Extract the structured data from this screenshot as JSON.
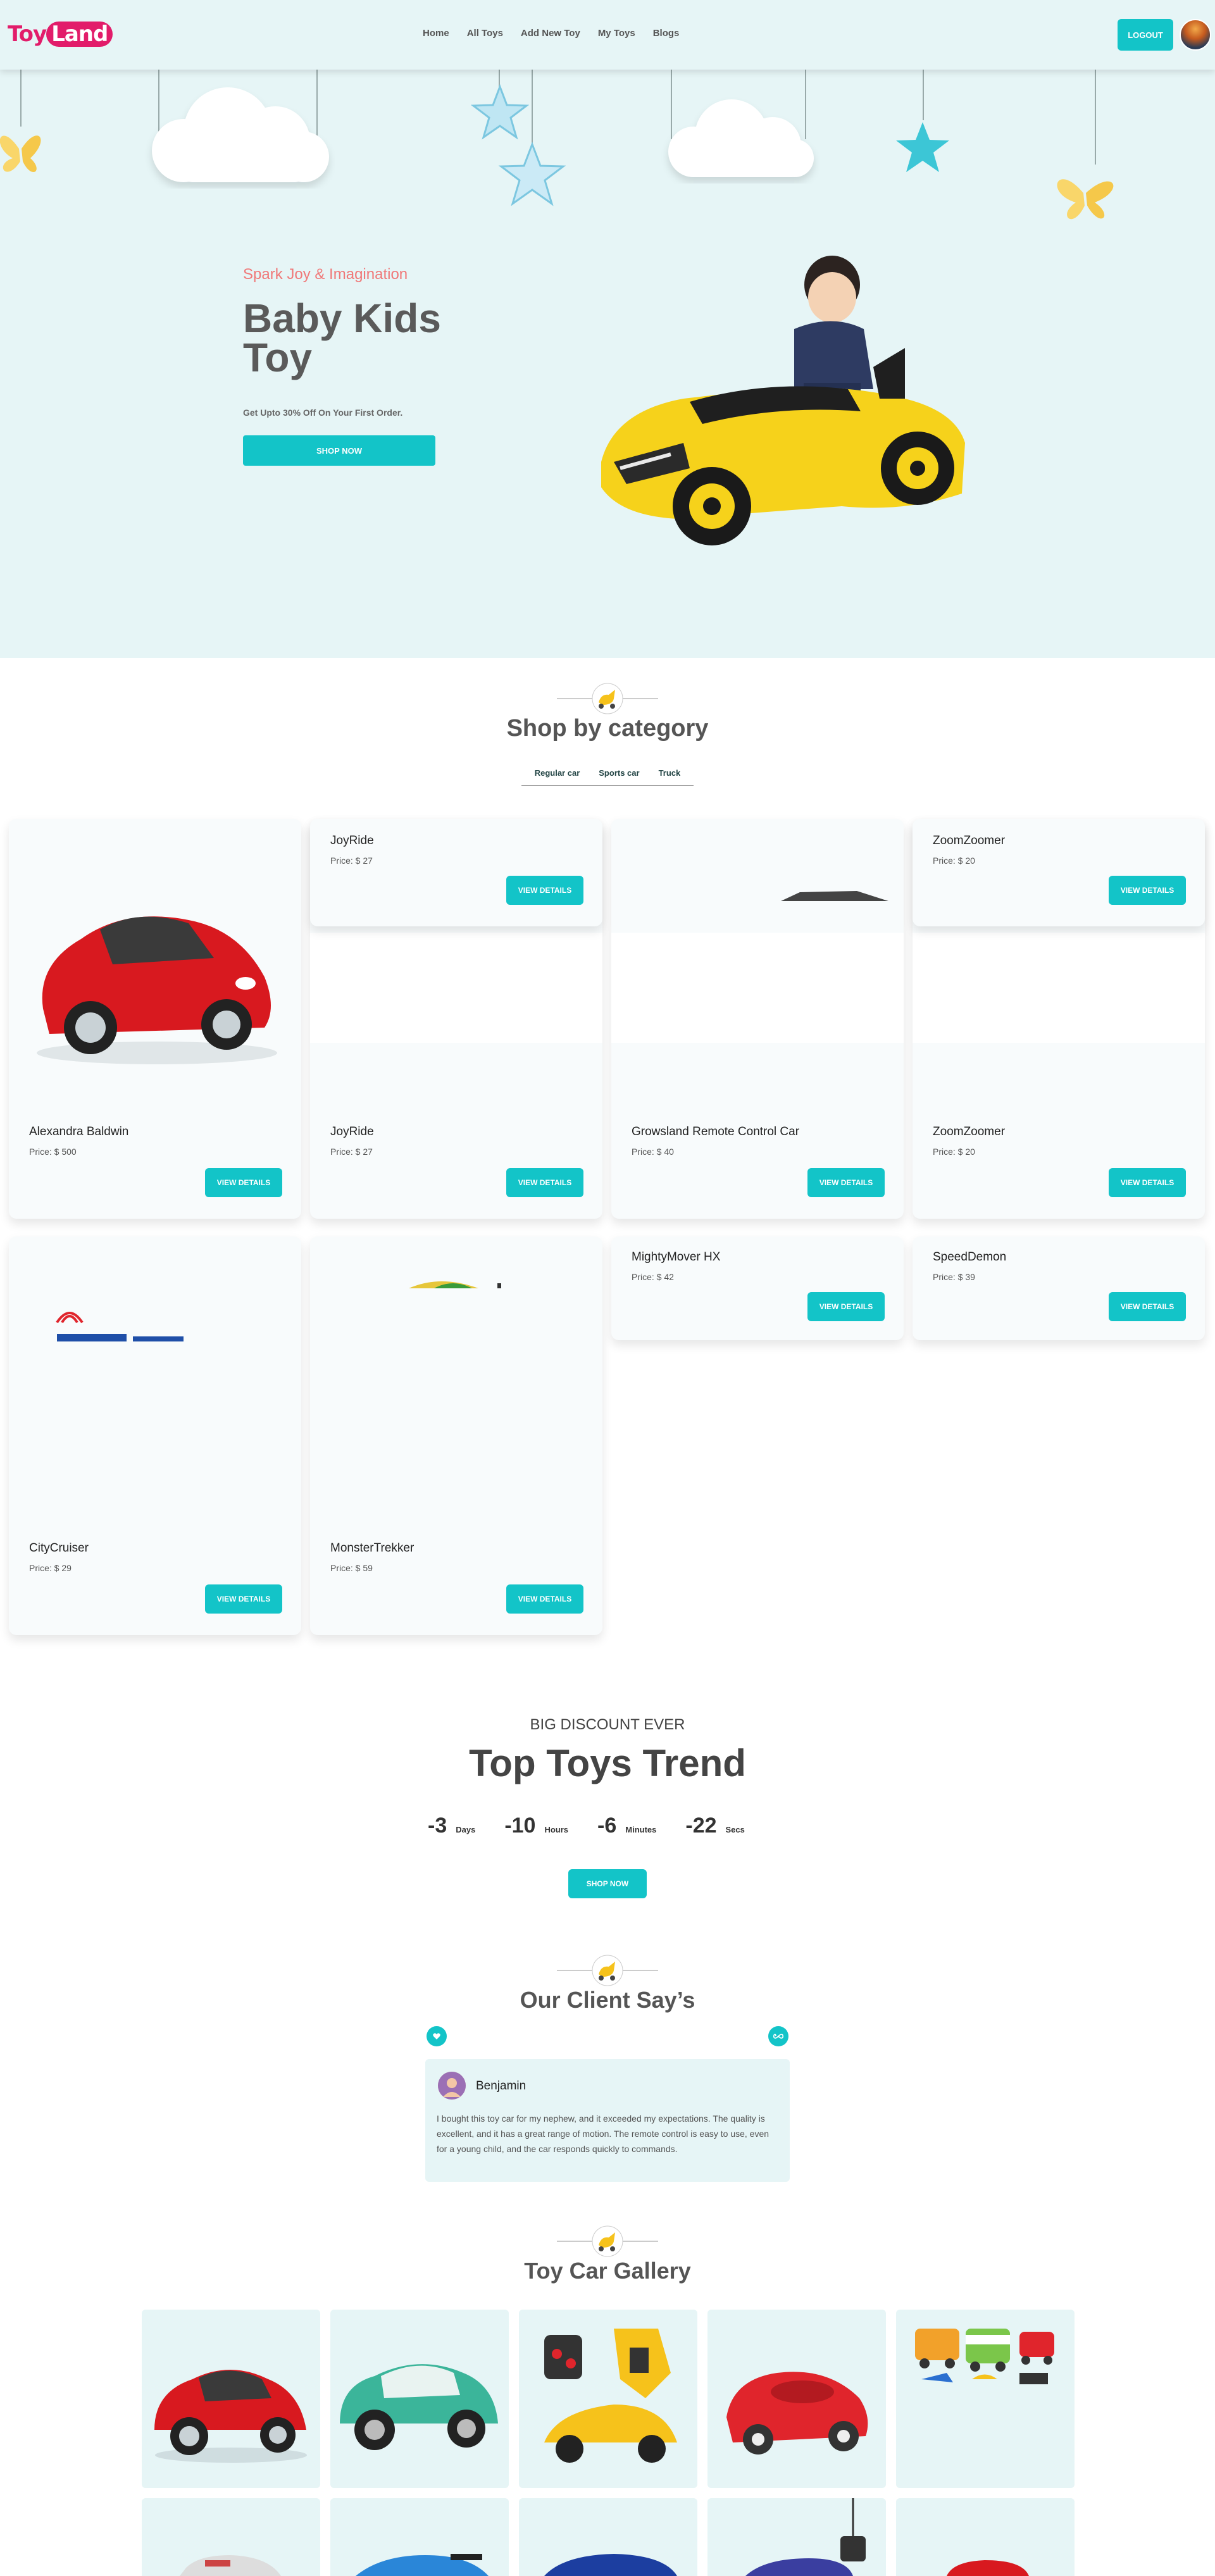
{
  "nav": {
    "logo_toy": "Toy",
    "logo_land": "Land",
    "links": [
      "Home",
      "All Toys",
      "Add New Toy",
      "My Toys",
      "Blogs"
    ],
    "logout_label": "LOGOUT"
  },
  "hero": {
    "subtitle": "Spark Joy & Imagination",
    "title_line1": "Baby Kids",
    "title_line2": "Toy",
    "offer": "Get Upto 30% Off On Your First Order.",
    "shop_label": "SHOP NOW"
  },
  "category": {
    "title": "Shop by category",
    "tabs": [
      "Regular car",
      "Sports car",
      "Truck"
    ],
    "button_label": "VIEW DETAILS",
    "cards": [
      {
        "name": "JoyRide",
        "price": "Price: $ 27"
      },
      {
        "name": "ZoomZoomer",
        "price": "Price: $ 20"
      },
      {
        "name": "Alexandra Baldwin",
        "price": "Price: $ 500"
      },
      {
        "name": "JoyRide",
        "price": "Price: $ 27"
      },
      {
        "name": "Growsland Remote Control Car",
        "price": "Price: $ 40"
      },
      {
        "name": "ZoomZoomer",
        "price": "Price: $ 20"
      },
      {
        "name": "MightyMover HX",
        "price": "Price: $ 42"
      },
      {
        "name": "SpeedDemon",
        "price": "Price: $ 39"
      },
      {
        "name": "CityCruiser",
        "price": "Price: $ 29"
      },
      {
        "name": "MonsterTrekker",
        "price": "Price: $ 59"
      }
    ]
  },
  "discount": {
    "kicker": "BIG DISCOUNT EVER",
    "title": "Top Toys Trend",
    "countdown": [
      {
        "value": "-3",
        "label": "Days"
      },
      {
        "value": "-10",
        "label": "Hours"
      },
      {
        "value": "-6",
        "label": "Minutes"
      },
      {
        "value": "-22",
        "label": "Secs"
      }
    ],
    "shop_label": "SHOP NOW"
  },
  "testimonials": {
    "title": "Our Client Say’s",
    "name": "Benjamin",
    "text": "I bought this toy car for my nephew, and it exceeded my expectations. The quality is excellent, and it has a great range of motion. The remote control is easy to use, even for a young child, and the car responds quickly to commands."
  },
  "gallery": {
    "title": "Toy Car Gallery"
  },
  "colors": {
    "accent": "#13c4c8",
    "hero_bg": "#e6f5f6",
    "logo_pink": "#e21c6a",
    "subtitle_coral": "#f07878"
  }
}
